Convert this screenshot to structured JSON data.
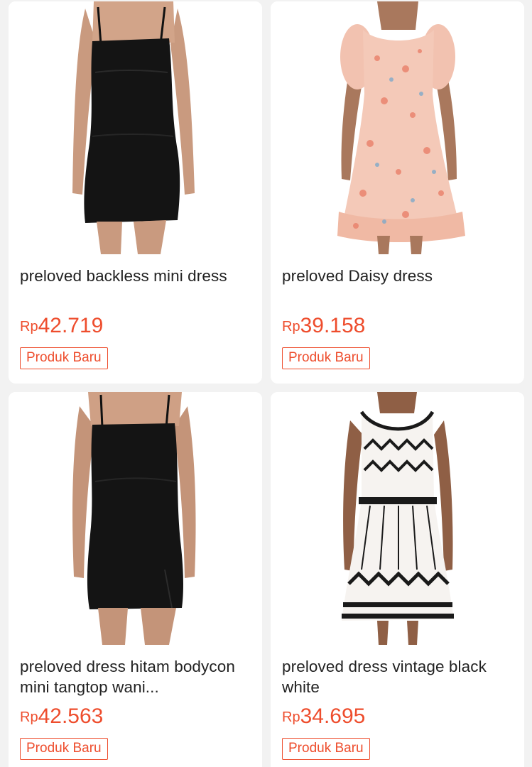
{
  "products": [
    {
      "title": "preloved backless mini dress",
      "currency": "Rp",
      "price": "42.719",
      "badge": "Produk Baru",
      "image": "black-mini-dress-photo"
    },
    {
      "title": "preloved Daisy dress",
      "currency": "Rp",
      "price": "39.158",
      "badge": "Produk Baru",
      "image": "floral-dress-photo"
    },
    {
      "title": "preloved dress hitam bodycon mini tangtop wani...",
      "currency": "Rp",
      "price": "42.563",
      "badge": "Produk Baru",
      "image": "black-bodycon-dress-photo"
    },
    {
      "title": "preloved dress vintage black white",
      "currency": "Rp",
      "price": "34.695",
      "badge": "Produk Baru",
      "image": "zigzag-dress-photo"
    }
  ],
  "colors": {
    "accent": "#ee4d2d",
    "text": "#222222",
    "background": "#f2f2f2",
    "card": "#ffffff"
  }
}
